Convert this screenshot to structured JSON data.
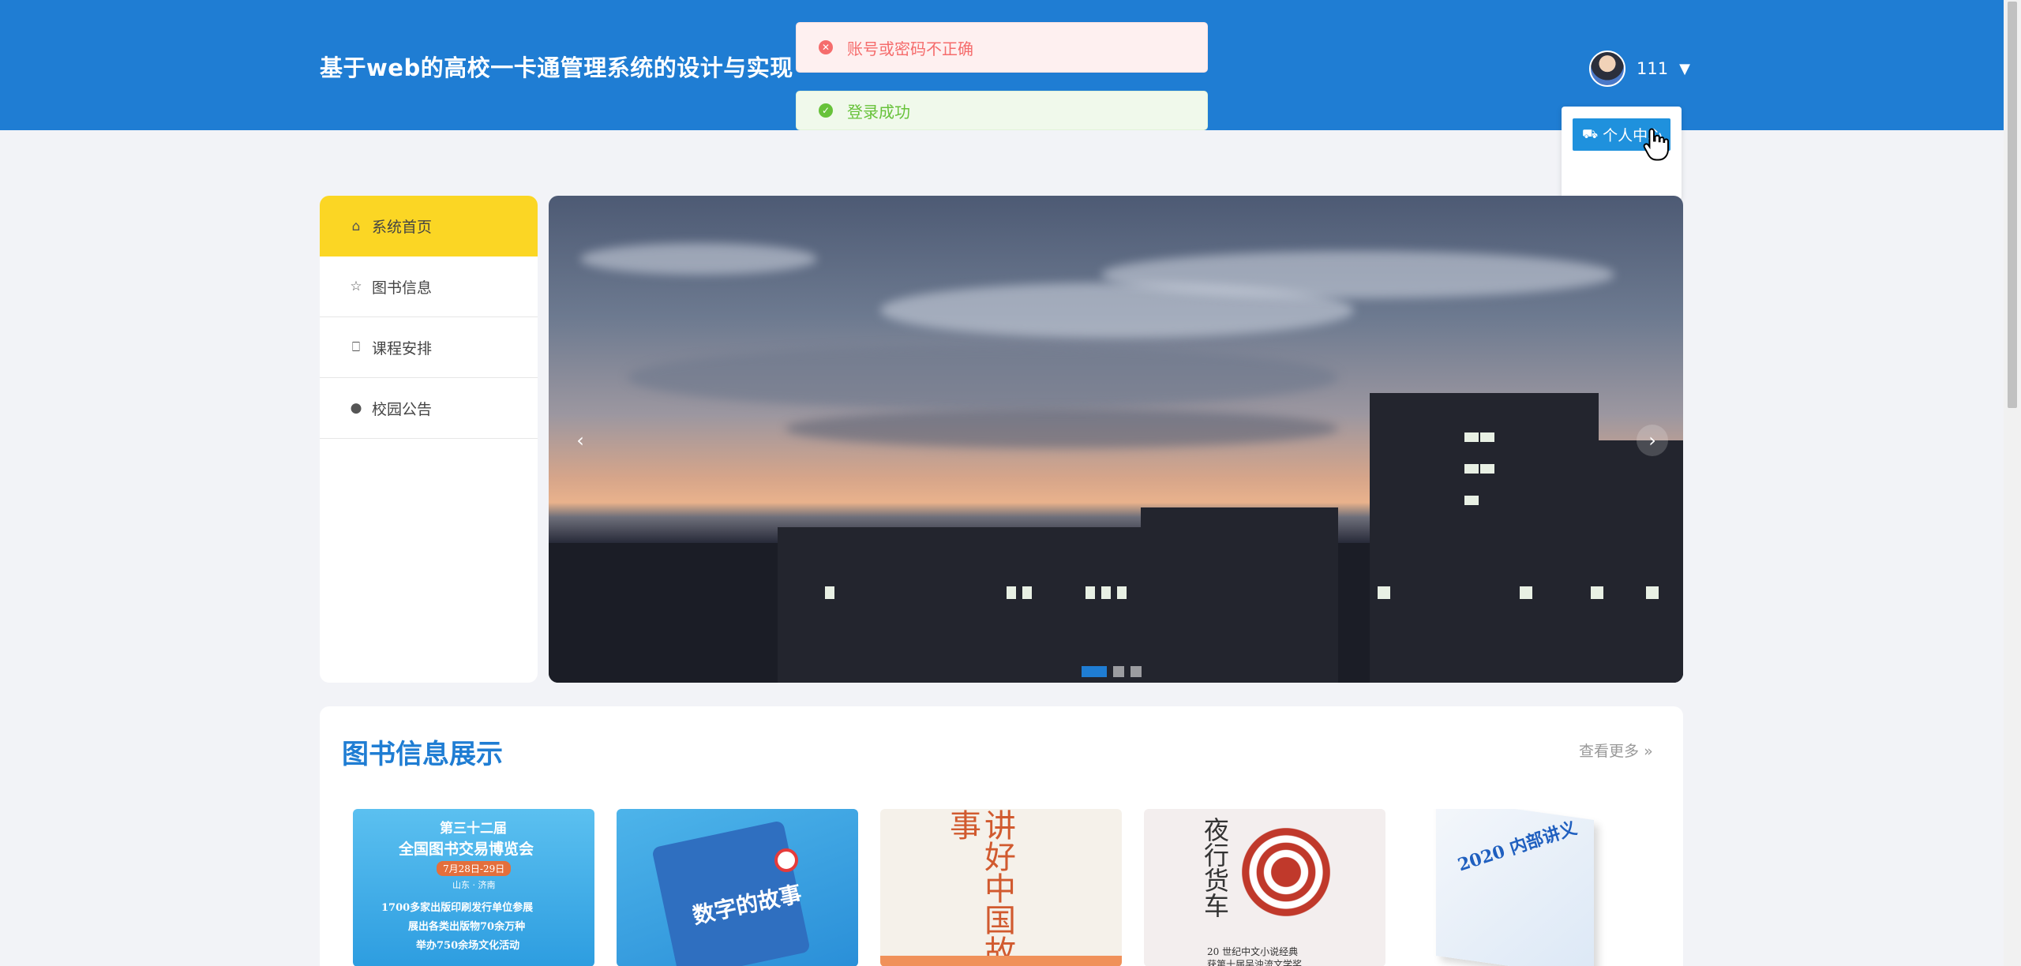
{
  "header": {
    "title": "基于web的高校一卡通管理系统的设计与实现",
    "user_name": "111",
    "dropdown_item": "个人中心"
  },
  "toasts": {
    "error": "账号或密码不正确",
    "success": "登录成功"
  },
  "sidebar": {
    "items": [
      {
        "label": "系统首页",
        "icon": "home-icon"
      },
      {
        "label": "图书信息",
        "icon": "star-icon"
      },
      {
        "label": "课程安排",
        "icon": "lock-icon"
      },
      {
        "label": "校园公告",
        "icon": "info-icon"
      }
    ]
  },
  "banner": {
    "slide_count": 3,
    "active_slide": 1
  },
  "books_section": {
    "title": "图书信息展示",
    "more": "查看更多",
    "books": [
      {
        "cover_line1": "第三十二届",
        "cover_line2": "全国图书交易博览会",
        "cover_line3": "7月28日-29日",
        "cover_line4": "山东 · 济南",
        "cover_line5": "1700多家出版印刷发行单位参展",
        "cover_line6": "展出各类出版物70余万种",
        "cover_line7": "举办750余场文化活动"
      },
      {
        "cover_title": "数字的故事"
      },
      {
        "cover_title": "讲好中国故事"
      },
      {
        "cover_title": "夜行货车",
        "cover_sub1": "20 世纪中文小说经典",
        "cover_sub2": "获第十届吴浊流文学奖"
      },
      {
        "cover_title": "2020 内部讲义"
      }
    ]
  }
}
